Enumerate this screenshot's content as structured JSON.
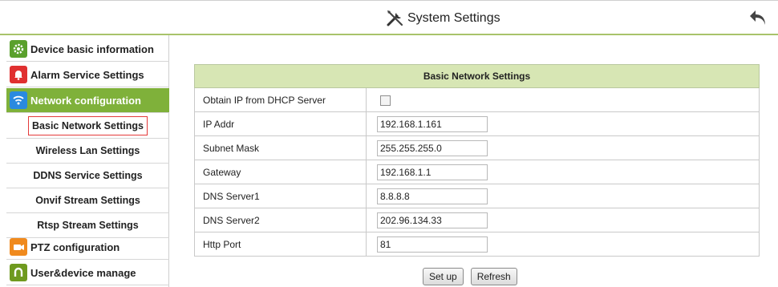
{
  "header": {
    "title": "System Settings"
  },
  "sidebar": {
    "categories": [
      {
        "label": "Device basic information",
        "icon": "gear-icon",
        "color": "#5aa02c"
      },
      {
        "label": "Alarm Service Settings",
        "icon": "bell-icon",
        "color": "#e03030"
      },
      {
        "label": "Network configuration",
        "icon": "wifi-icon",
        "color": "#2a8ae0"
      },
      {
        "label": "PTZ configuration",
        "icon": "camera-icon",
        "color": "#f08a1e"
      },
      {
        "label": "User&device manage",
        "icon": "user-icon",
        "color": "#6f9a1f"
      }
    ],
    "network_subitems": [
      "Basic Network Settings",
      "Wireless Lan Settings",
      "DDNS Service Settings",
      "Onvif Stream Settings",
      "Rtsp Stream Settings"
    ]
  },
  "form": {
    "title": "Basic Network Settings",
    "dhcp_label": "Obtain IP from DHCP Server",
    "dhcp_checked": false,
    "fields": [
      {
        "label": "IP Addr",
        "value": "192.168.1.161"
      },
      {
        "label": "Subnet Mask",
        "value": "255.255.255.0"
      },
      {
        "label": "Gateway",
        "value": "192.168.1.1"
      },
      {
        "label": "DNS Server1",
        "value": "8.8.8.8"
      },
      {
        "label": "DNS Server2",
        "value": "202.96.134.33"
      },
      {
        "label": "Http Port",
        "value": "81"
      }
    ]
  },
  "buttons": {
    "setup": "Set up",
    "refresh": "Refresh"
  },
  "colors": {
    "accent": "#7fb13a",
    "table_header": "#d7e6b4",
    "selected_border": "#e43a3a"
  }
}
